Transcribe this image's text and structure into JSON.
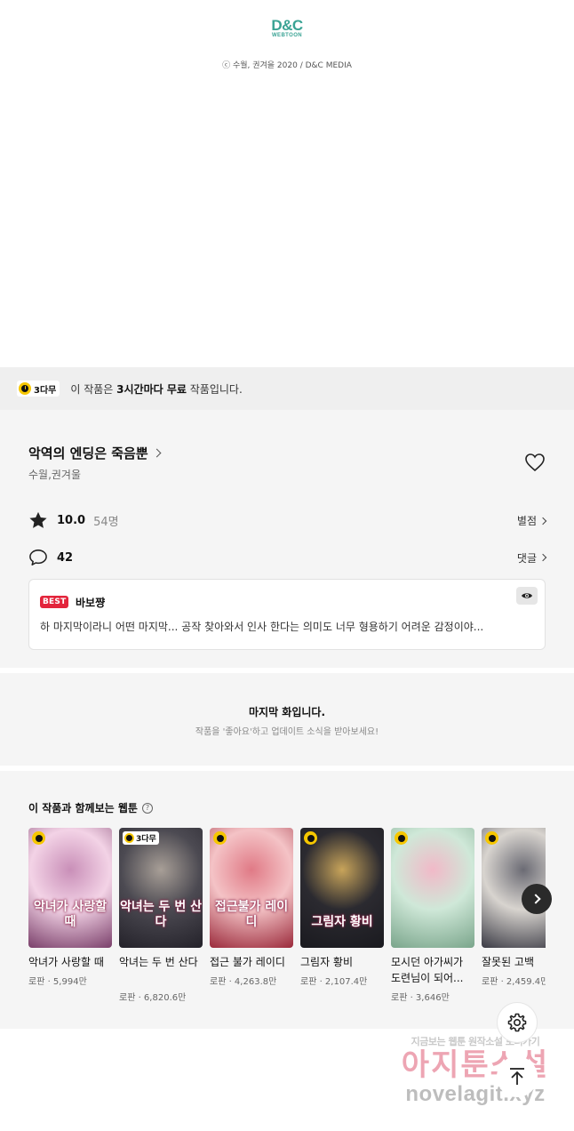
{
  "header": {
    "logo_main": "D&C",
    "logo_sub": "WEBTOON",
    "copyright": "ⓒ 수월, 권겨을 2020 / D&C MEDIA"
  },
  "free_bar": {
    "badge": "3다무",
    "text_pre": "이 작품은 ",
    "text_bold": "3시간마다 무료",
    "text_post": " 작품입니다."
  },
  "work": {
    "title": "악역의 엔딩은 죽음뿐",
    "author": "수월,권겨울",
    "rating": "10.0",
    "rating_count": "54명",
    "rating_link": "별점",
    "comment_count": "42",
    "comment_link": "댓글"
  },
  "best_comment": {
    "tag": "BEST",
    "user": "바보쨩",
    "text": "하 마지막이라니 어떤 마지막... 공작 찾아와서 인사 한다는 의미도 너무 형용하기 어려운 감정이야..."
  },
  "last_episode": {
    "title": "마지막 화입니다.",
    "subtitle": "작품을 '좋아요'하고 업데이트 소식을 받아보세요!"
  },
  "recommendations": {
    "title": "이 작품과 함께보는 웹툰",
    "help_icon": "?",
    "items": [
      {
        "name": "악녀가 사랑할 때",
        "meta": "로판 · 5,994만",
        "badge": "",
        "cover_text": "악녀가 사랑할 때",
        "colors": [
          "#f3d3e6",
          "#c98fb8",
          "#7a3f6a"
        ]
      },
      {
        "name": "악녀는 두 번 산다",
        "meta": "로판 · 6,820.6만",
        "badge": "3다무",
        "cover_text": "악녀는 두 번 산다",
        "colors": [
          "#4c4a52",
          "#a89f97",
          "#24222a"
        ]
      },
      {
        "name": "접근 불가 레이디",
        "meta": "로판 · 4,263.8만",
        "badge": "",
        "cover_text": "접근불가 레이디",
        "colors": [
          "#f4c3c6",
          "#e07a86",
          "#9b2a3b"
        ]
      },
      {
        "name": "그림자 황비",
        "meta": "로판 · 2,107.4만",
        "badge": "",
        "cover_text": "그림자 황비",
        "colors": [
          "#2b2a30",
          "#c8a45a",
          "#1a1a1f"
        ]
      },
      {
        "name": "모시던 아가씨가 도련님이 되어...",
        "meta": "로판 · 3,646만",
        "badge": "",
        "cover_text": "",
        "colors": [
          "#cfe8d8",
          "#f1b9c8",
          "#7aa58b"
        ]
      },
      {
        "name": "잘못된 고백",
        "meta": "로판 · 2,459.4만",
        "badge": "",
        "cover_text": "",
        "colors": [
          "#d8d4cf",
          "#6b6b74",
          "#3a3a44"
        ]
      }
    ]
  },
  "watermark": {
    "top": "지금보는 웹툰 원작소설 보러가기",
    "mid": "아지툰소설",
    "bottom": "novelagit.xyz"
  },
  "colors": {
    "accent_yellow": "#f6c700",
    "best_red": "#e3243b",
    "logo_teal": "#3aa394",
    "panel_gray": "#f5f5f5"
  }
}
